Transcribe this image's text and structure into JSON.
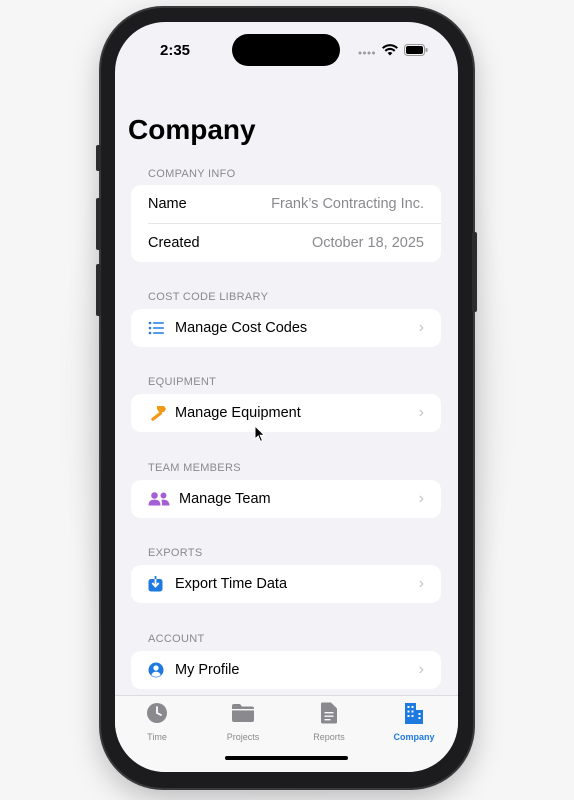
{
  "status": {
    "time": "2:35"
  },
  "page": {
    "title": "Company"
  },
  "company_info": {
    "header": "COMPANY INFO",
    "rows": [
      {
        "key": "Name",
        "value": "Frank’s Contracting Inc."
      },
      {
        "key": "Created",
        "value": "October 18, 2025"
      }
    ]
  },
  "cost_codes": {
    "header": "COST CODE LIBRARY",
    "item": "Manage Cost Codes",
    "icon": "list-icon"
  },
  "equipment": {
    "header": "EQUIPMENT",
    "item": "Manage Equipment",
    "icon": "hammer-icon"
  },
  "team": {
    "header": "TEAM MEMBERS",
    "item": "Manage Team",
    "icon": "people-icon"
  },
  "exports": {
    "header": "EXPORTS",
    "item": "Export Time Data",
    "icon": "download-icon"
  },
  "account": {
    "header": "ACCOUNT",
    "item": "My Profile",
    "icon": "person-circle-icon"
  },
  "tabs": [
    {
      "label": "Time",
      "icon": "clock-icon",
      "active": false
    },
    {
      "label": "Projects",
      "icon": "folder-icon",
      "active": false
    },
    {
      "label": "Reports",
      "icon": "document-icon",
      "active": false
    },
    {
      "label": "Company",
      "icon": "building-icon",
      "active": true
    }
  ],
  "colors": {
    "accent": "#1f7ae0",
    "equipment_icon": "#f29a18",
    "team_icon": "#a45fd6",
    "background": "#f2f2f7"
  }
}
